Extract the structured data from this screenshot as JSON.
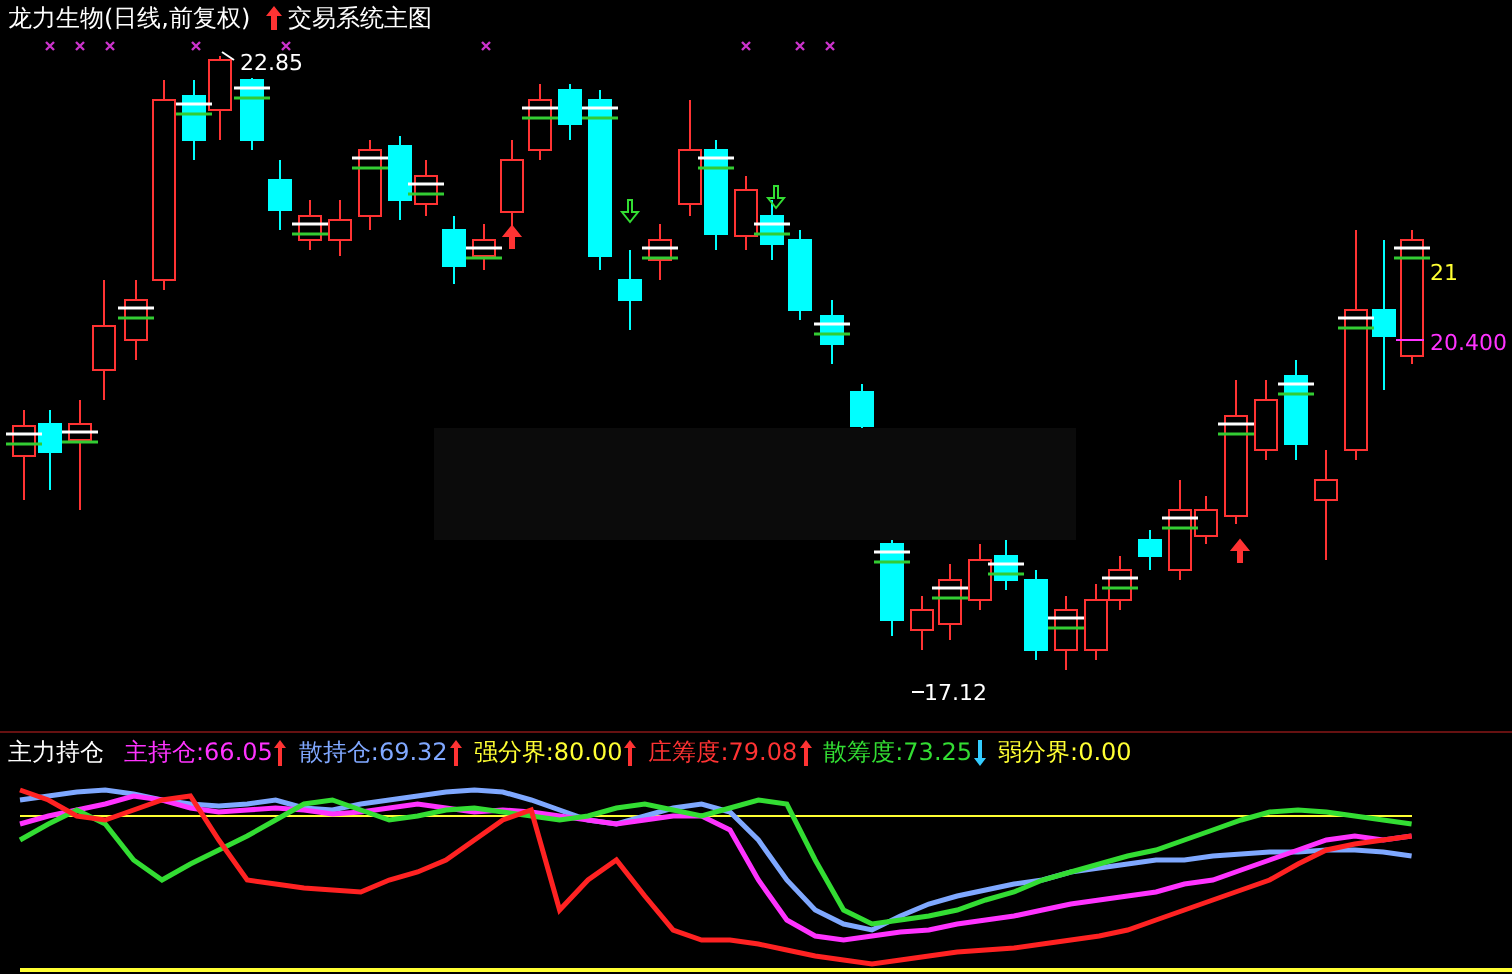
{
  "chart_header": {
    "title": "龙力生物(日线,前复权)",
    "indicator": "交易系统主图"
  },
  "price_labels": [
    {
      "kind": "high",
      "text": "22.85"
    },
    {
      "kind": "low",
      "text": "17.12"
    },
    {
      "kind": "level",
      "text": "21"
    },
    {
      "kind": "level2",
      "text": "20.400"
    }
  ],
  "indicator_panel": {
    "title": "主力持仓",
    "items": [
      {
        "label": "主持仓:",
        "value": "66.05",
        "color": "#ff33ff",
        "kind": "up"
      },
      {
        "label": "散持仓:",
        "value": "69.32",
        "color": "#80a8ff",
        "kind": "up"
      },
      {
        "label": "强分界:",
        "value": "80.00",
        "color": "#ffff33",
        "kind": "up"
      },
      {
        "label": "庄筹度:",
        "value": "79.08",
        "color": "#ff3333",
        "kind": "up"
      },
      {
        "label": "散筹度:",
        "value": "73.25",
        "color": "#33dd33",
        "kind": "down"
      },
      {
        "label": "弱分界:",
        "value": "0.00",
        "color": "#ffff33",
        "kind": "plain"
      }
    ]
  }
}
